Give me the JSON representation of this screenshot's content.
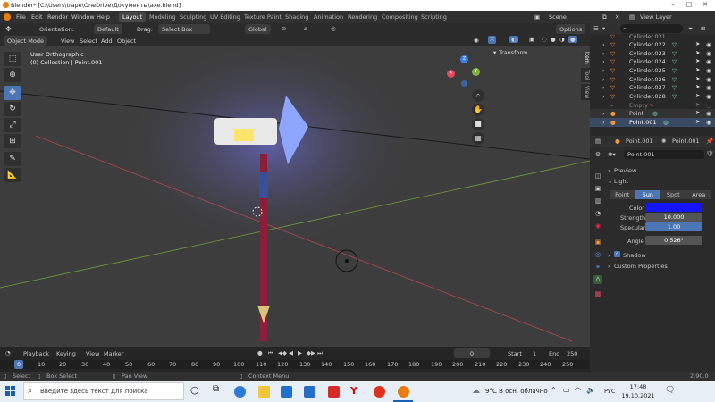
{
  "window": {
    "title": "Blender* [C:\\Users\\trape\\OneDrive\\Документы\\axe.blend]"
  },
  "topbar": {
    "menus": [
      "File",
      "Edit",
      "Render",
      "Window",
      "Help"
    ],
    "workspaces": [
      "Layout",
      "Modeling",
      "Sculpting",
      "UV Editing",
      "Texture Paint",
      "Shading",
      "Animation",
      "Rendering",
      "Compositing",
      "Scripting"
    ],
    "active_workspace": "Layout",
    "scene_label": "Scene",
    "view_layer_label": "View Layer"
  },
  "header": {
    "orientation_label": "Orientation:",
    "orientation_value": "Default",
    "drag_label": "Drag:",
    "drag_value": "Select Box",
    "transform_orientation": "Global",
    "options_label": "Options",
    "mode": "Object Mode",
    "menu_view": "View",
    "menu_select": "Select",
    "menu_add": "Add",
    "menu_object": "Object"
  },
  "viewport": {
    "view_name": "User Orthographic",
    "collection_info": "(0) Collection | Point.001",
    "transform_label": "Transform",
    "gizmo_axes": [
      "X",
      "Y",
      "Z"
    ],
    "side_tabs": [
      "Item",
      "Tool",
      "View"
    ]
  },
  "outliner": {
    "search_placeholder": "",
    "rows": [
      {
        "name": "Cylinder.021"
      },
      {
        "name": "Cylinder.022"
      },
      {
        "name": "Cylinder.023"
      },
      {
        "name": "Cylinder.024"
      },
      {
        "name": "Cylinder.025"
      },
      {
        "name": "Cylinder.026"
      },
      {
        "name": "Cylinder.027"
      },
      {
        "name": "Cylinder.028"
      },
      {
        "name": "Empty"
      },
      {
        "name": "Point"
      },
      {
        "name": "Point.001"
      }
    ]
  },
  "properties": {
    "object_name": "Point.001",
    "data_name": "Point.001",
    "datablock_name": "Point.001",
    "sections": {
      "preview": "Preview",
      "light": "Light",
      "shadow": "Shadow",
      "custom": "Custom Properties"
    },
    "light_types": [
      "Point",
      "Sun",
      "Spot",
      "Area"
    ],
    "active_light_type": "Sun",
    "color_label": "Color",
    "color_value": "#1414ff",
    "strength_label": "Strength",
    "strength_value": "10.000",
    "specular_label": "Specular",
    "specular_value": "1.00",
    "angle_label": "Angle",
    "angle_value": "0.526°"
  },
  "timeline": {
    "menus": [
      "Playback",
      "Keying",
      "View",
      "Marker"
    ],
    "current_frame": "0",
    "start_label": "Start",
    "start_value": "1",
    "end_label": "End",
    "end_value": "250",
    "ruler": [
      "0",
      "10",
      "20",
      "30",
      "40",
      "50",
      "60",
      "70",
      "80",
      "90",
      "100",
      "110",
      "120",
      "130",
      "140",
      "150",
      "160",
      "170",
      "180",
      "190",
      "200",
      "210",
      "220",
      "230",
      "240",
      "250"
    ]
  },
  "statusbar": {
    "select": "Select",
    "box_select": "Box Select",
    "pan_view": "Pan View",
    "context_menu": "Context Menu",
    "version": "2.90.0"
  },
  "taskbar": {
    "search_placeholder": "Введите здесь текст для поиска",
    "weather": "9°C В осн. облачно",
    "lang": "РУС",
    "time": "17:48",
    "date": "19.10.2021"
  },
  "colors": {
    "accent": "#4c75b5",
    "x_axis": "#e04a5a",
    "y_axis": "#7fb43c",
    "z_axis": "#3b7ee6",
    "light_color": "#1414ff"
  }
}
